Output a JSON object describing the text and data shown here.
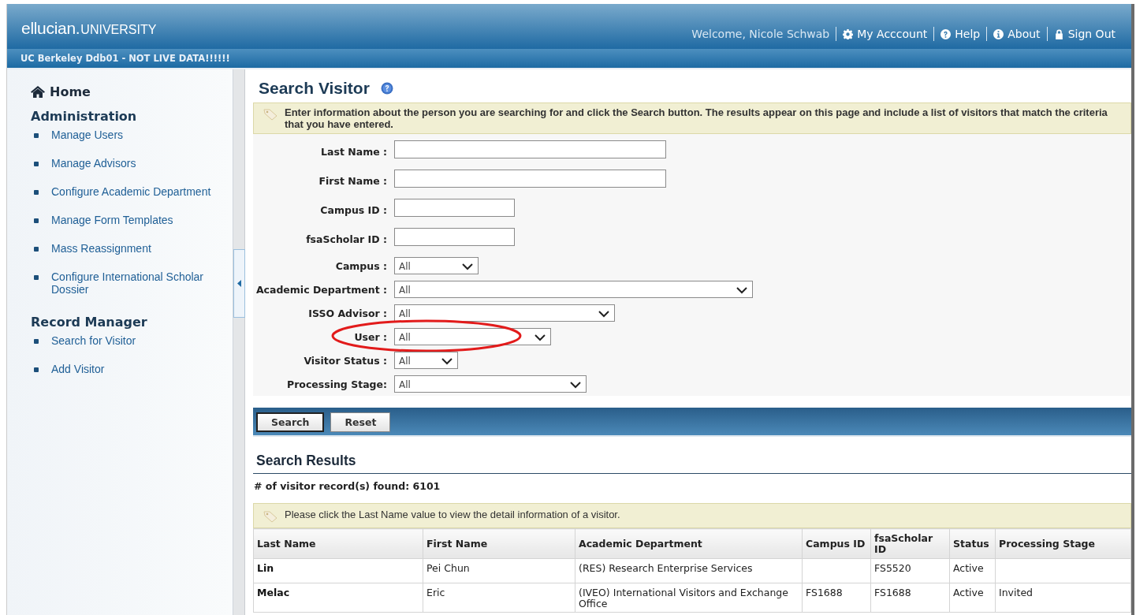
{
  "header": {
    "logo_main": "ellucian.",
    "logo_sub": "UNIVERSITY",
    "welcome": "Welcome, Nicole Schwab",
    "links": [
      {
        "kind": "account",
        "label": "My Acccount"
      },
      {
        "kind": "help",
        "label": "Help"
      },
      {
        "kind": "about",
        "label": "About"
      },
      {
        "kind": "signout",
        "label": "Sign Out"
      }
    ]
  },
  "environment_bar": "UC Berkeley Ddb01 - NOT LIVE DATA!!!!!!",
  "sidebar": {
    "home": "Home",
    "sections": [
      {
        "title": "Administration",
        "items": [
          "Manage Users",
          "Manage Advisors",
          "Configure Academic Department",
          "Manage Form Templates",
          "Mass Reassignment",
          "Configure International Scholar Dossier"
        ]
      },
      {
        "title": "Record Manager",
        "items": [
          "Search for Visitor",
          "Add Visitor"
        ]
      }
    ]
  },
  "page_title": "Search Visitor",
  "instructions": "Enter information about the person you are searching for and click the Search button. The results appear on this page and include a list of visitors that match the criteria that you have entered.",
  "form_fields": [
    {
      "label": "Last Name :",
      "kind": "text"
    },
    {
      "label": "First Name :",
      "kind": "text"
    },
    {
      "label": "Campus ID :",
      "kind": "text"
    },
    {
      "label": "fsaScholar ID :",
      "kind": "text"
    },
    {
      "label": "Campus :",
      "kind": "select",
      "value": "All"
    },
    {
      "label": "Academic Department :",
      "kind": "select",
      "value": "All"
    },
    {
      "label": "ISSO Advisor :",
      "kind": "select",
      "value": "All"
    },
    {
      "label": "User :",
      "kind": "select",
      "value": "All",
      "circled": true
    },
    {
      "label": "Visitor Status :",
      "kind": "select",
      "value": "All"
    },
    {
      "label": "Processing Stage:",
      "kind": "select",
      "value": "All"
    }
  ],
  "buttons": [
    "Search",
    "Reset"
  ],
  "results": {
    "title": "Search Results",
    "count": "# of visitor record(s) found: 6101",
    "hint": "Please click the Last Name value to view the detail information of a visitor.",
    "table": {
      "columns": [
        "Last Name",
        "First Name",
        "Academic Department",
        "Campus ID",
        "fsaScholar ID",
        "Status",
        "Processing Stage"
      ],
      "rows": [
        [
          "Lin",
          "Pei Chun",
          "(RES) Research Enterprise Services",
          null,
          "FS5520",
          "Active",
          null
        ],
        [
          "Melac",
          "Eric",
          "(IVEO) International Visitors and Exchange Office",
          "FS1688",
          "FS1688",
          "Active",
          "Invited"
        ]
      ]
    }
  }
}
